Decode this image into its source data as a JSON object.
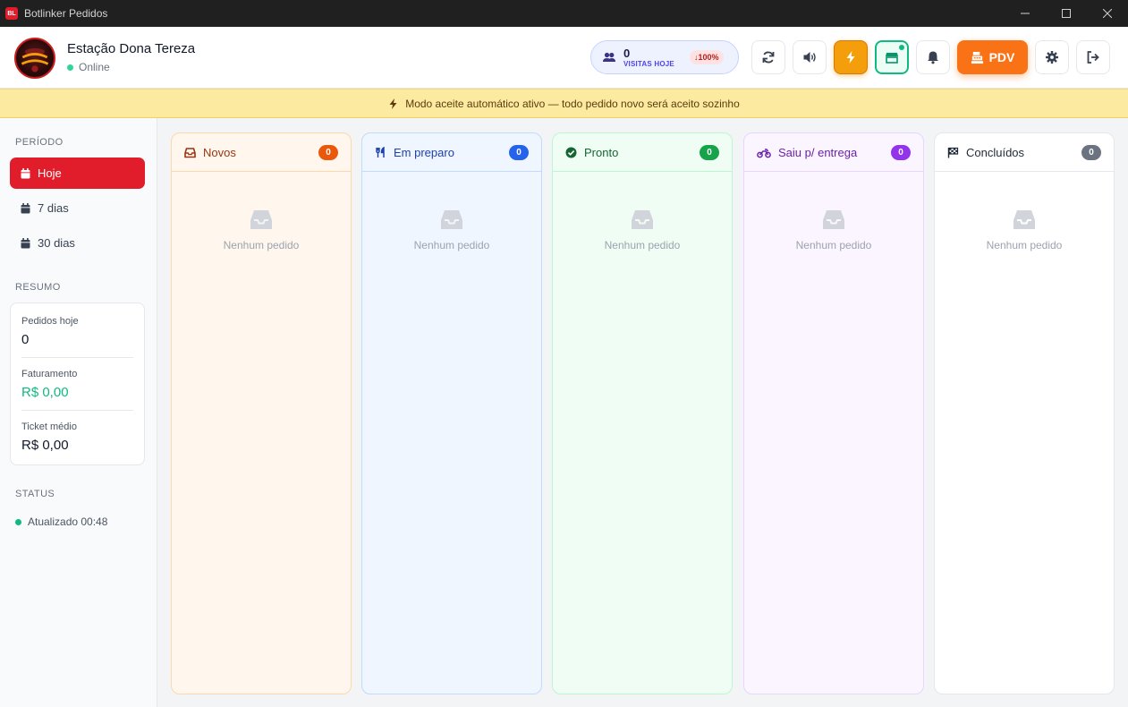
{
  "window": {
    "title": "Botlinker Pedidos",
    "icon_text": "BL"
  },
  "header": {
    "store_name": "Estação Dona Tereza",
    "status": "Online",
    "visits": {
      "count": "0",
      "label": "VISITAS HOJE",
      "trend": "↓100%"
    },
    "pdv_label": "PDV"
  },
  "banner": {
    "text": "Modo aceite automático ativo — todo pedido novo será aceito sozinho"
  },
  "sidebar": {
    "period_title": "PERÍODO",
    "periods": [
      {
        "label": "Hoje"
      },
      {
        "label": "7 dias"
      },
      {
        "label": "30 dias"
      }
    ],
    "summary_title": "RESUMO",
    "summary": [
      {
        "label": "Pedidos hoje",
        "value": "0"
      },
      {
        "label": "Faturamento",
        "value": "R$ 0,00"
      },
      {
        "label": "Ticket médio",
        "value": "R$ 0,00"
      }
    ],
    "status_title": "STATUS",
    "status_text": "Atualizado 00:48"
  },
  "columns": [
    {
      "title": "Novos",
      "count": "0",
      "empty": "Nenhum pedido",
      "icon": "inbox-icon",
      "bg": "#fff7ed",
      "border": "#fed7aa",
      "text": "#9a3412",
      "badge": "#ea580c"
    },
    {
      "title": "Em preparo",
      "count": "0",
      "empty": "Nenhum pedido",
      "icon": "utensils-icon",
      "bg": "#eff6ff",
      "border": "#bfdbfe",
      "text": "#1e40af",
      "badge": "#2563eb"
    },
    {
      "title": "Pronto",
      "count": "0",
      "empty": "Nenhum pedido",
      "icon": "check-circle-icon",
      "bg": "#f0fdf4",
      "border": "#bbf7d0",
      "text": "#166534",
      "badge": "#16a34a"
    },
    {
      "title": "Saiu p/ entrega",
      "count": "0",
      "empty": "Nenhum pedido",
      "icon": "motorcycle-icon",
      "bg": "#faf5ff",
      "border": "#e9d5ff",
      "text": "#6b21a8",
      "badge": "#9333ea"
    },
    {
      "title": "Concluídos",
      "count": "0",
      "empty": "Nenhum pedido",
      "icon": "flag-checkered-icon",
      "bg": "#ffffff",
      "border": "#e5e7eb",
      "text": "#1f2937",
      "badge": "#6b7280"
    }
  ]
}
